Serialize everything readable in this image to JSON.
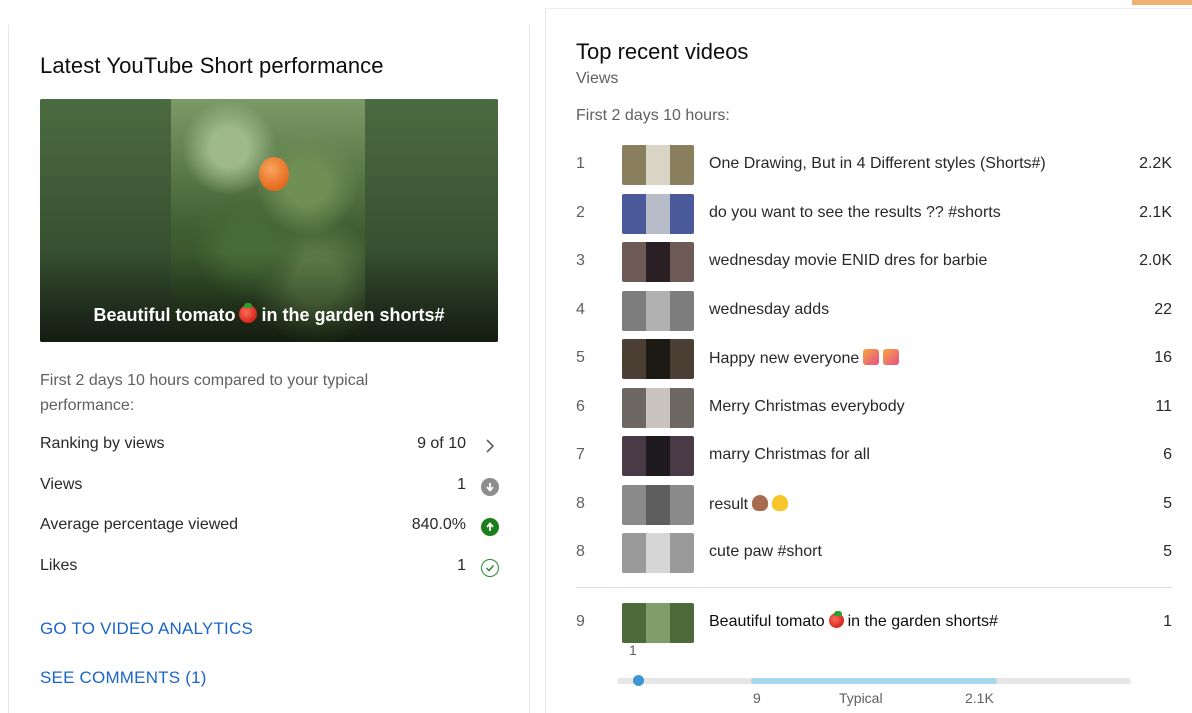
{
  "left": {
    "title": "Latest YouTube Short performance",
    "hero_caption_before": "Beautiful tomato",
    "hero_caption_after": "in the garden shorts#",
    "compare_text": "First 2 days 10 hours compared to your typical performance:",
    "metrics": [
      {
        "label": "Ranking by views",
        "value": "9 of 10",
        "icon": "chevron-right-icon"
      },
      {
        "label": "Views",
        "value": "1",
        "icon": "arrow-down-circle-icon"
      },
      {
        "label": "Average percentage viewed",
        "value": "840.0%",
        "icon": "arrow-up-circle-icon"
      },
      {
        "label": "Likes",
        "value": "1",
        "icon": "check-circle-icon"
      }
    ],
    "links": {
      "analytics": "GO TO VIDEO ANALYTICS",
      "comments": "SEE COMMENTS (1)"
    }
  },
  "right": {
    "title": "Top recent videos",
    "subtitle": "Views",
    "period": "First 2 days 10 hours:",
    "videos": [
      {
        "rank": "1",
        "title": "One Drawing, But in 4 Different styles (Shorts#)",
        "views": "2.2K",
        "thumb_color": "#8a7f5c"
      },
      {
        "rank": "2",
        "title": "do you want to see the results ?? #shorts",
        "views": "2.1K",
        "thumb_color": "#4a5a9a"
      },
      {
        "rank": "3",
        "title": "wednesday movie ENID dres for barbie",
        "views": "2.0K",
        "thumb_color": "#6e5a56"
      },
      {
        "rank": "4",
        "title": "wednesday adds",
        "views": "22",
        "thumb_color": "#7d7d7d"
      },
      {
        "rank": "5",
        "title": "Happy new everyone",
        "views": "16",
        "thumb_color": "#4a3f32"
      },
      {
        "rank": "6",
        "title": "Merry Christmas everybody",
        "views": "11",
        "thumb_color": "#6d6762"
      },
      {
        "rank": "7",
        "title": "marry Christmas for all",
        "views": "6",
        "thumb_color": "#4a3a45"
      },
      {
        "rank": "8",
        "title": "result",
        "views": "5",
        "thumb_color": "#8a8a8a"
      },
      {
        "rank": "8",
        "title": "cute paw #short",
        "views": "5",
        "thumb_color": "#9a9a9a"
      }
    ],
    "current": {
      "rank": "9",
      "title_before": "Beautiful tomato",
      "title_after": "in the garden shorts#",
      "views": "1",
      "thumb_color": "#4d6b3a"
    },
    "range": {
      "current_label": "1",
      "low": "9",
      "mid": "Typical",
      "high": "2.1K"
    }
  },
  "colors": {
    "link": "#1a66c8",
    "up": "#1a7f1a",
    "range_dot": "#3d95d3",
    "range_typical": "#a8d8ec"
  }
}
